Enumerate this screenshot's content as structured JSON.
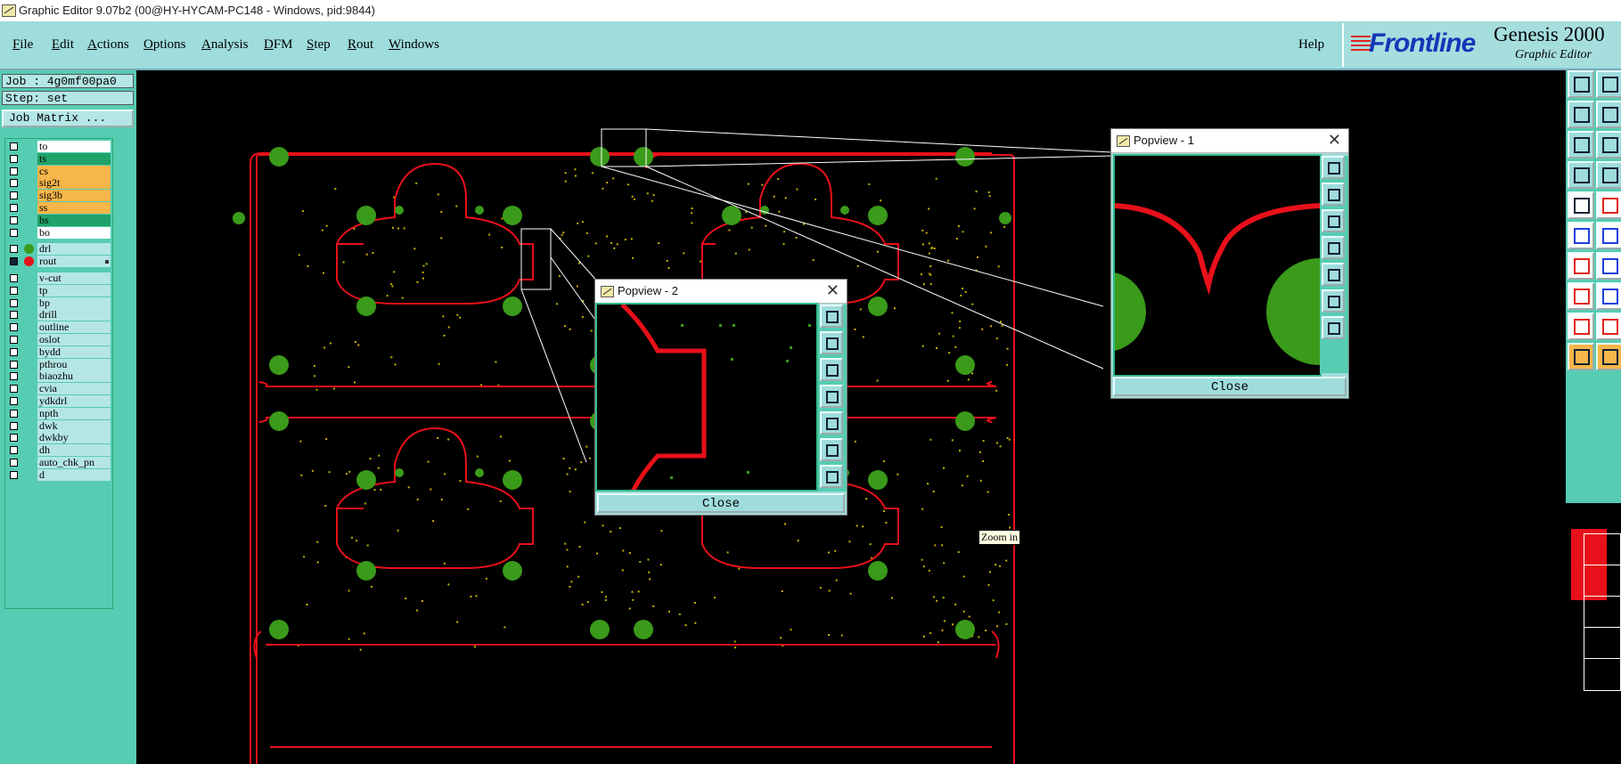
{
  "window": {
    "title": "Graphic Editor 9.07b2 (00@HY-HYCAM-PC148 - Windows, pid:9844)"
  },
  "menu": {
    "items": [
      "File",
      "Edit",
      "Actions",
      "Options",
      "Analysis",
      "DFM",
      "Step",
      "Rout",
      "Windows"
    ],
    "help": "Help"
  },
  "brand": {
    "logo": "Frontline",
    "product": "Genesis 2000",
    "subtitle": "Graphic Editor",
    "logo_color": "#1636b8",
    "accent": "#e2231a"
  },
  "job": {
    "job": "Job : 4g0mf00pa0",
    "step": "Step: set",
    "matrix_button": "Job Matrix ..."
  },
  "layers": [
    {
      "name": "to",
      "color": "#ffffff",
      "dot": ""
    },
    {
      "name": "ts",
      "color": "#1fa36a",
      "dot": ""
    },
    {
      "name": "cs",
      "color": "#f6b64a",
      "dot": ""
    },
    {
      "name": "sig2t",
      "color": "#f6b64a",
      "dot": ""
    },
    {
      "name": "sig3b",
      "color": "#f6b64a",
      "dot": ""
    },
    {
      "name": "ss",
      "color": "#f6b64a",
      "dot": ""
    },
    {
      "name": "bs",
      "color": "#1fa36a",
      "dot": ""
    },
    {
      "name": "bo",
      "color": "#ffffff",
      "dot": ""
    },
    {
      "name": "drl",
      "color": "#b5e6e6",
      "dot": "#3a9a1a",
      "affected": true
    },
    {
      "name": "rout",
      "color": "#b5e6e6",
      "dot": "#e8101a",
      "affected": true,
      "work": true
    },
    {
      "name": "v-cut",
      "color": "#b5e6e6",
      "dot": ""
    },
    {
      "name": "tp",
      "color": "#b5e6e6",
      "dot": ""
    },
    {
      "name": "bp",
      "color": "#b5e6e6",
      "dot": ""
    },
    {
      "name": "drill",
      "color": "#b5e6e6",
      "dot": ""
    },
    {
      "name": "outline",
      "color": "#b5e6e6",
      "dot": ""
    },
    {
      "name": "oslot",
      "color": "#b5e6e6",
      "dot": ""
    },
    {
      "name": "bydd",
      "color": "#b5e6e6",
      "dot": ""
    },
    {
      "name": "pthrou",
      "color": "#b5e6e6",
      "dot": ""
    },
    {
      "name": "biaozhu",
      "color": "#b5e6e6",
      "dot": ""
    },
    {
      "name": "cvia",
      "color": "#b5e6e6",
      "dot": ""
    },
    {
      "name": "ydkdrl",
      "color": "#b5e6e6",
      "dot": ""
    },
    {
      "name": "npth",
      "color": "#b5e6e6",
      "dot": ""
    },
    {
      "name": "dwk",
      "color": "#b5e6e6",
      "dot": ""
    },
    {
      "name": "dwkby",
      "color": "#b5e6e6",
      "dot": ""
    },
    {
      "name": "dh",
      "color": "#b5e6e6",
      "dot": ""
    },
    {
      "name": "auto_chk_pn",
      "color": "#b5e6e6",
      "dot": ""
    },
    {
      "name": "d",
      "color": "#b5e6e6",
      "dot": ""
    }
  ],
  "popview1": {
    "title": "Popview - 1",
    "close": "Close"
  },
  "popview2": {
    "title": "Popview - 2",
    "close": "Close"
  },
  "tooltip": "Zoom in",
  "colors": {
    "rout": "#e8101a",
    "drill": "#3a9a1a",
    "pads": "#c8b400",
    "panel": "#56ccb2",
    "menubar": "#9fdcdc"
  }
}
